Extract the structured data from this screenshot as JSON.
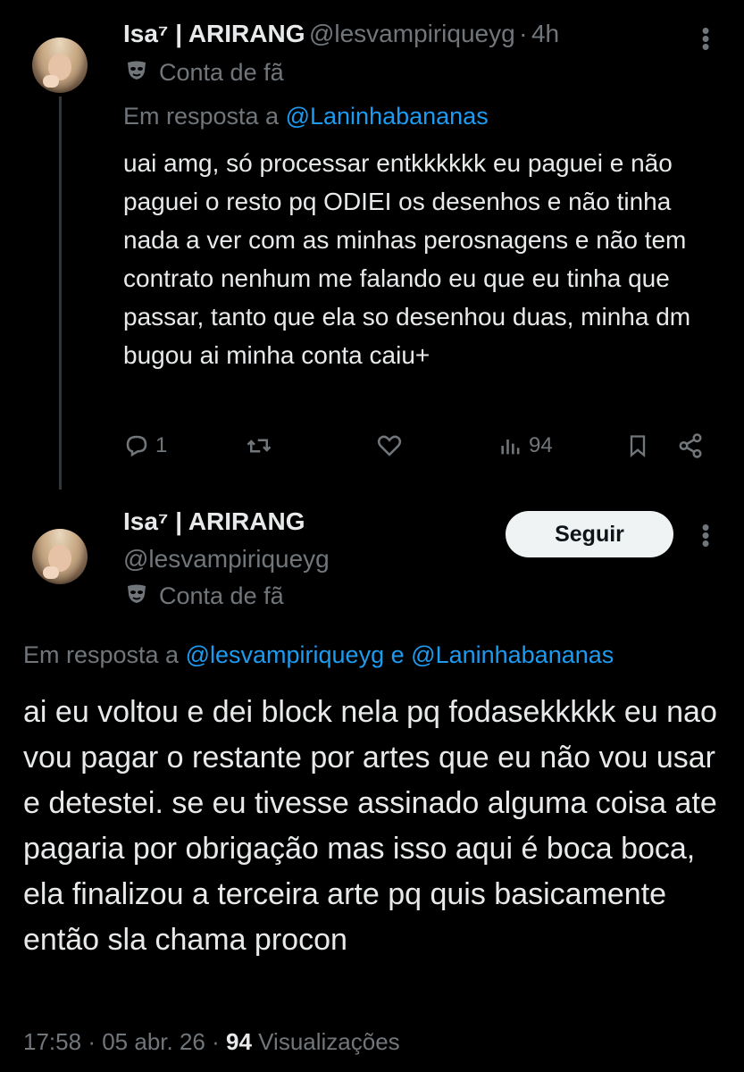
{
  "reply_tweet": {
    "display_name": "Isa⁷ | ARIRANG",
    "handle": "@lesvampiriqueyg",
    "time": "4h",
    "badge": "Conta de fã",
    "reply_prefix": "Em resposta a",
    "reply_to": "@Laninhabananas",
    "text": "uai amg, só processar entkkkkkk eu paguei e não paguei o resto pq ODIEI os desenhos e não tinha nada a ver com as minhas perosnagens e não tem contrato nenhum me falando eu que eu tinha que passar, tanto que ela so desenhou duas, minha dm bugou ai minha conta caiu+",
    "reply_count": "1",
    "view_count": "94"
  },
  "main_tweet": {
    "display_name": "Isa⁷ | ARIRANG",
    "handle": "@lesvampiriqueyg",
    "badge": "Conta de fã",
    "follow_label": "Seguir",
    "reply_prefix": "Em resposta a",
    "reply_to_1": "@lesvampiriqueyg",
    "reply_and": "e",
    "reply_to_2": "@Laninhabananas",
    "text": "ai eu voltou e dei block nela pq fodasekkkkk eu nao vou pagar o restante por artes que eu não vou usar e detestei. se eu tivesse assinado alguma coisa ate pagaria por obrigação mas isso aqui é boca boca, ela finalizou a terceira arte pq quis basicamente então sla chama  procon",
    "time": "17:58",
    "date": "05 abr. 26",
    "views": "94",
    "views_label": "Visualizações"
  },
  "icons": {
    "badge": "theater-mask-icon",
    "reply": "reply-icon",
    "retweet": "retweet-icon",
    "like": "heart-icon",
    "views": "views-chart-icon",
    "bookmark": "bookmark-icon",
    "share": "share-icon",
    "more": "more-icon"
  },
  "colors": {
    "background": "#000000",
    "text": "#e7e9ea",
    "muted": "#71767b",
    "link": "#1d9bf0",
    "follow_bg": "#eff3f4"
  }
}
